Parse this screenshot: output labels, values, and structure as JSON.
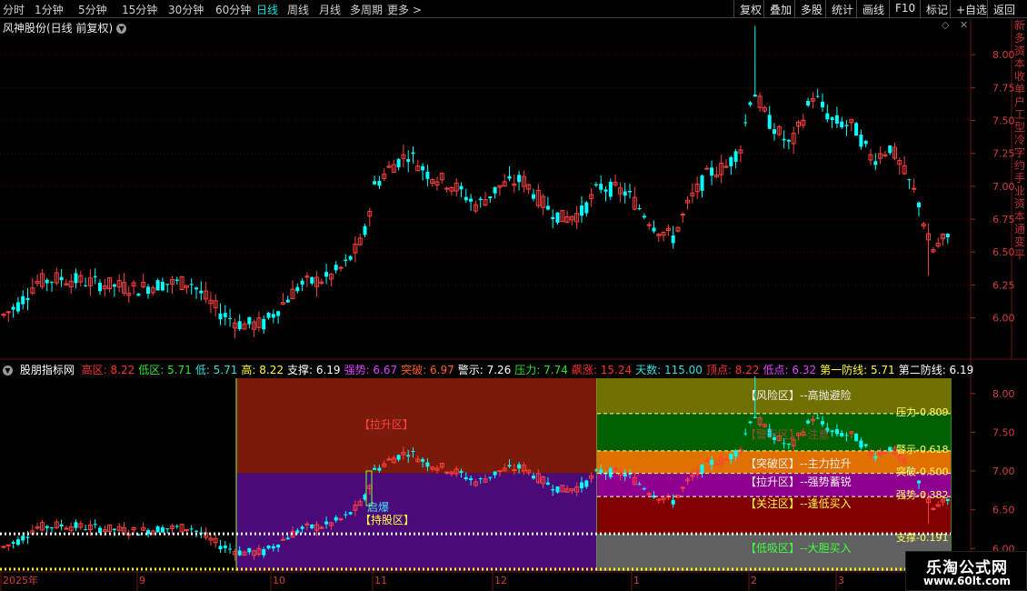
{
  "toolbar": {
    "periods": [
      "分时",
      "1分钟",
      "5分钟",
      "15分钟",
      "30分钟",
      "60分钟",
      "日线",
      "周线",
      "月线",
      "多周期",
      "更多 >"
    ],
    "active_period": "日线",
    "right_buttons": [
      "复权",
      "叠加",
      "多股",
      "统计",
      "画线",
      "F10",
      "标记",
      "+自选",
      "返回"
    ]
  },
  "main_title": "风神股份(日线 前复权)",
  "main_axis": {
    "labels": [
      "8.00",
      "7.75",
      "7.50",
      "7.25",
      "7.00",
      "6.75",
      "6.50",
      "6.25",
      "6.00"
    ],
    "values": [
      8.0,
      7.75,
      7.5,
      7.25,
      7.0,
      6.75,
      6.5,
      6.25,
      6.0
    ],
    "range": [
      5.7,
      8.25
    ]
  },
  "right_strip_text": "新多资本收单户工型冷字约手业资本通变平",
  "indicator": {
    "name": "股朋指标网",
    "fields": [
      {
        "label": "高区:",
        "value": "8.22",
        "color": "#ff3030"
      },
      {
        "label": "低区:",
        "value": "5.71",
        "color": "#30e030"
      },
      {
        "label": "低:",
        "value": "5.71",
        "color": "#30e0e0"
      },
      {
        "label": "高:",
        "value": "8.22",
        "color": "#ffff30"
      },
      {
        "label": "支撑:",
        "value": "6.19",
        "color": "#ffffff"
      },
      {
        "label": "强势:",
        "value": "6.67",
        "color": "#e040ff"
      },
      {
        "label": "突破:",
        "value": "6.97",
        "color": "#ff6020"
      },
      {
        "label": "警示:",
        "value": "7.26",
        "color": "#ffffff"
      },
      {
        "label": "压力:",
        "value": "7.74",
        "color": "#30e030"
      },
      {
        "label": "飙涨:",
        "value": "15.24",
        "color": "#ff3030"
      },
      {
        "label": "天数:",
        "value": "115.00",
        "color": "#30e0e0"
      },
      {
        "label": "顶点:",
        "value": "8.22",
        "color": "#ff3030"
      },
      {
        "label": "低点:",
        "value": "6.32",
        "color": "#e040ff"
      },
      {
        "label": "第一防线:",
        "value": "5.71",
        "color": "#ffff30"
      },
      {
        "label": "第二防线:",
        "value": "6.19",
        "color": "#ffffff"
      }
    ],
    "axis_labels": [
      "8.00",
      "7.50",
      "7.00",
      "6.50",
      "6.00"
    ],
    "axis_values": [
      8.0,
      7.5,
      7.0,
      6.5,
      6.0
    ],
    "range": [
      5.71,
      8.22
    ],
    "zone_left": [
      "【拉升区】",
      "启爆",
      "【持股区】"
    ],
    "zone_right": [
      {
        "label": "【风险区】--高抛避险",
        "color": "#f0f0f0"
      },
      {
        "label": "【突破区】--主力拉升",
        "color": "#f0f0f0"
      },
      {
        "label": "【拉升区】--强势蓄锐",
        "color": "#f0f0f0"
      },
      {
        "label": "【关注区】--逢低买入",
        "color": "#ffff40"
      },
      {
        "label": "【低吸区】--大胆买入",
        "color": "#40ff40"
      }
    ],
    "faded_label": "【警示区】--注意",
    "ratio_labels": [
      "压力-0.809",
      "警示-0.618",
      "突破-0.500",
      "强势-0.382",
      "支撑-0.191"
    ]
  },
  "dates": [
    "2025年",
    "9",
    "10",
    "11",
    "12",
    "1",
    "2",
    "3"
  ],
  "watermark": {
    "title": "乐淘公式网",
    "url": "www.60lt.com"
  },
  "colors": {
    "up": "#ff4040",
    "down": "#00ffff"
  }
}
